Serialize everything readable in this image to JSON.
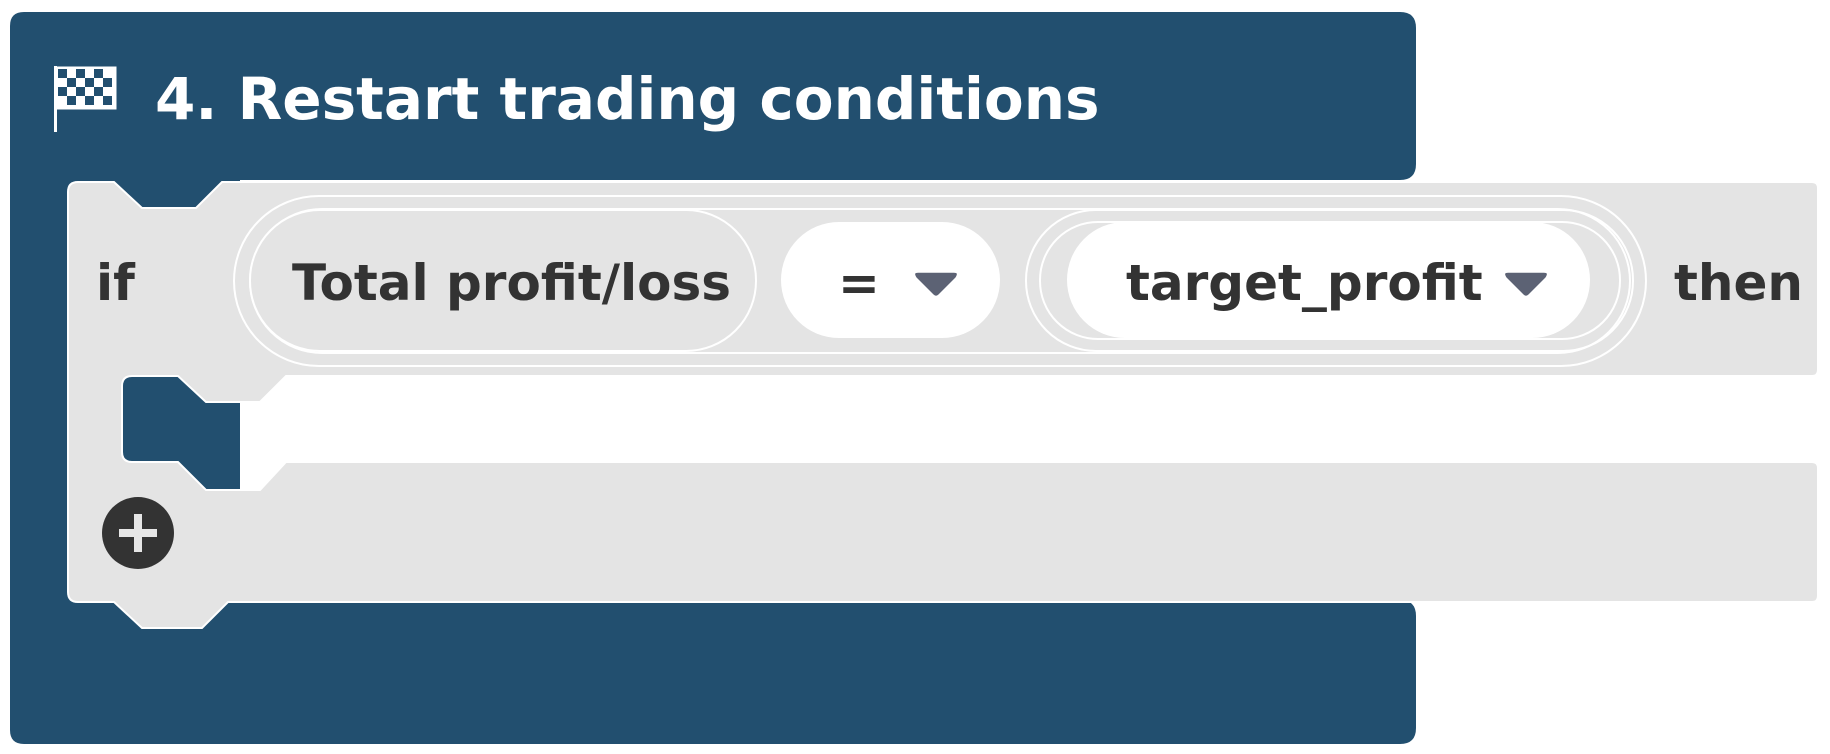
{
  "header": {
    "title": "4. Restart trading conditions",
    "icon": "checkered-flag-icon"
  },
  "if_block": {
    "if_label": "if",
    "then_label": "then",
    "condition": {
      "left_value": "Total profit/loss",
      "operator": "=",
      "right_value": "target_profit"
    },
    "add_button_icon": "plus-icon"
  },
  "colors": {
    "header_bg": "#224f6f",
    "block_bg": "#e4e4e4",
    "field_bg": "#ffffff",
    "text": "#333333",
    "dropdown_arrow": "#5c6274",
    "add_button_bg": "#333333"
  }
}
